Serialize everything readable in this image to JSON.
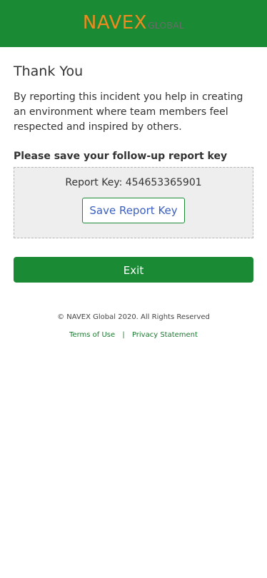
{
  "header": {
    "logo_main": "NAVEX",
    "logo_sub": "GLOBAL"
  },
  "main": {
    "title": "Thank You",
    "intro": "By reporting this incident you help in creating an environment where team members feel respected and inspired by others.",
    "save_prompt": "Please save your follow-up report key",
    "report_key_label": "Report Key: 454653365901",
    "save_button_label": "Save Report Key",
    "exit_button_label": "Exit"
  },
  "footer": {
    "copyright": "© NAVEX Global 2020. All Rights Reserved",
    "terms_link": "Terms of Use",
    "separator": "|",
    "privacy_link": "Privacy Statement"
  },
  "colors": {
    "brand_green": "#1a8a35",
    "logo_orange": "#f08a1e",
    "link_blue": "#3a5fc0"
  }
}
